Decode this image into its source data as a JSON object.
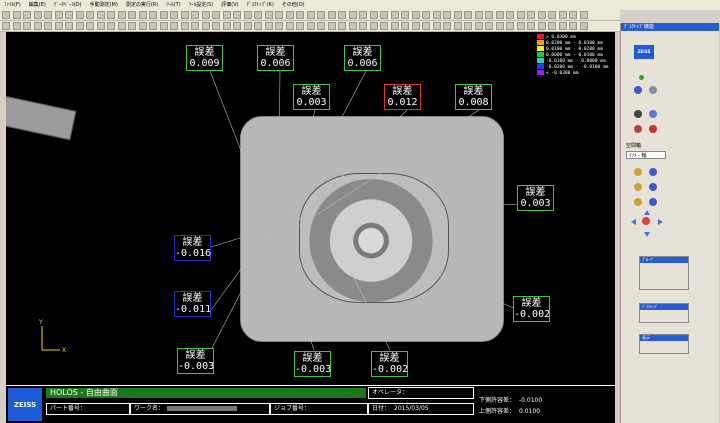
{
  "menu": [
    "ﾌｧｲﾙ(F)",
    "編集(E)",
    "ﾃﾞｰﾀﾍﾞｰｽ(D)",
    "手動測定(M)",
    "測定の実行(R)",
    "ﾂｰﾙ(T)",
    "ﾂｰﾙ設定(S)",
    "評価(V)",
    "ﾃﾞｽｸﾄｯﾌﾟ(K)",
    "その他(O)"
  ],
  "legend": [
    {
      "label": ">  0.0300 mm",
      "color": "#e02020"
    },
    {
      "label": "0.0200 mm - 0.0300 mm",
      "color": "#f0a020"
    },
    {
      "label": "0.0100 mm - 0.0200 mm",
      "color": "#f0f020"
    },
    {
      "label": "0.0000 mm - 0.0100 mm",
      "color": "#20d020"
    },
    {
      "label": "-0.0100 mm - 0.0000 mm",
      "color": "#20d0d0"
    },
    {
      "label": "-0.0200 mm - -0.0100 mm",
      "color": "#2040e0"
    },
    {
      "label": "<  -0.0300 mm",
      "color": "#a020e0"
    }
  ],
  "labels": [
    {
      "title": "誤差",
      "value": "0.009"
    },
    {
      "title": "誤差",
      "value": "0.006"
    },
    {
      "title": "誤差",
      "value": "0.006"
    },
    {
      "title": "誤差",
      "value": "0.003"
    },
    {
      "title": "誤差",
      "value": "0.012"
    },
    {
      "title": "誤差",
      "value": "0.008"
    },
    {
      "title": "誤差",
      "value": "0.003"
    },
    {
      "title": "誤差",
      "value": "-0.016"
    },
    {
      "title": "誤差",
      "value": "-0.011"
    },
    {
      "title": "誤差",
      "value": "-0.002"
    },
    {
      "title": "誤差",
      "value": "-0.003"
    },
    {
      "title": "誤差",
      "value": "-0.003"
    },
    {
      "title": "誤差",
      "value": "-0.002"
    }
  ],
  "axis": {
    "x": "X",
    "y": "Y"
  },
  "info": {
    "logo": "ZEISS",
    "program": "HOLOS - 自由曲面",
    "operator_label": "オペレータ：",
    "part_label": "パート番号：",
    "work_label": "ワーク名：",
    "job_label": "ジョブ番号：",
    "date_label": "日付：",
    "date_value": "2015/03/05",
    "lower_tol_label": "下側許容差：",
    "lower_tol_value": "-0.0100",
    "upper_tol_label": "上側許容差：",
    "upper_tol_value": "0.0100"
  },
  "side": {
    "title": "ﾃﾞｽｸﾄｯﾌﾟ機能",
    "logo": "ZEISS",
    "view_label": "空間軸",
    "view_value": "ｲｿﾒ - 軸",
    "panel1": "ﾌﾟﾛｰﾌﾞ",
    "panel2": "ﾃﾞｽｸﾄｯﾌﾟ",
    "panel3": "表示"
  }
}
